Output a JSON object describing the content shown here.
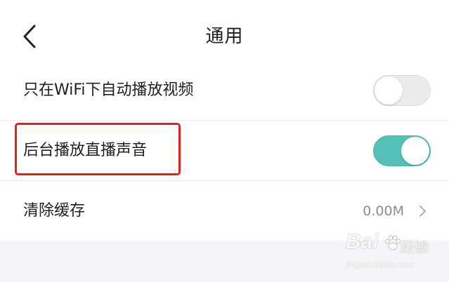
{
  "header": {
    "title": "通用",
    "back_icon": "chevron-left-icon"
  },
  "settings": [
    {
      "label": "只在WiFi下自动播放视频",
      "control": "toggle",
      "enabled": false
    },
    {
      "label": "后台播放直播声音",
      "control": "toggle",
      "enabled": true,
      "highlighted": true
    },
    {
      "label": "清除缓存",
      "control": "value-chevron",
      "value": "0.00M",
      "icon": "chevron-right-icon"
    }
  ],
  "colors": {
    "toggle_on": "#55c0b7",
    "toggle_off": "#ececec",
    "highlight": "#e81f1f",
    "footer_background": "#f5f5f7"
  },
  "watermark": {
    "brand": "Bai",
    "brand_suffix": "经验",
    "url": "jingyan.baidu.com",
    "icon": "paw-icon"
  }
}
